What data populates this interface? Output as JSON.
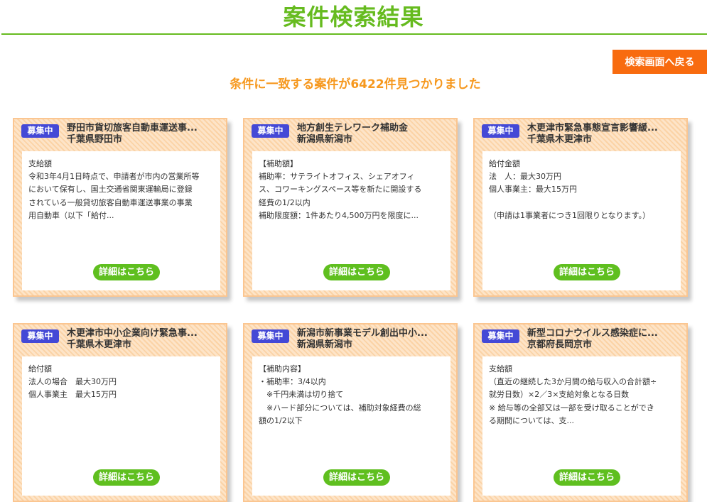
{
  "colors": {
    "title_green": "#66bb1f",
    "accent_orange": "#f6981e",
    "button_orange": "#f86b0f",
    "card_border": "#fbc691",
    "badge_blue": "#4449d6",
    "detail_green": "#5fbf1f"
  },
  "page": {
    "title": "案件検索結果",
    "back_button": "検索画面へ戻る",
    "result_summary": "条件に一致する案件が6422件見つかりました"
  },
  "cards": [
    {
      "status": "募集中",
      "title": "野田市貨切旅客自動車運送事...",
      "location": "千葉県野田市",
      "text": "支給額\n令和3年4月1日時点で、申請者が市内の営業所等\nにおいて保有し、国土交通省関東運輸局に登録\nされている一般貸切旅客自動車運送事業の事業\n用自動車（以下「給付...",
      "detail_label": "詳細はこちら"
    },
    {
      "status": "募集中",
      "title": "地方創生テレワーク補助金",
      "location": "新潟県新潟市",
      "text": "【補助額】\n補助率：サテライトオフィス、シェアオフィ\nス、コワーキングスペース等を新たに開設する\n経費の1/2以内\n補助限度額：1件あたり4,500万円を限度に...",
      "detail_label": "詳細はこちら"
    },
    {
      "status": "募集中",
      "title": "木更津市緊急事態宣言影響緩...",
      "location": "千葉県木更津市",
      "text": "給付金額\n法　人：最大30万円\n個人事業主：最大15万円\n\n（申請は1事業者につき1回限りとなります。）",
      "detail_label": "詳細はこちら"
    },
    {
      "status": "募集中",
      "title": "木更津市中小企業向け緊急事...",
      "location": "千葉県木更津市",
      "text": "給付額\n法人の場合　最大30万円\n個人事業主　最大15万円",
      "detail_label": "詳細はこちら"
    },
    {
      "status": "募集中",
      "title": "新潟市新事業モデル創出中小...",
      "location": "新潟県新潟市",
      "text": "【補助内容】\n・補助率：3/4以内\n　※千円未満は切り捨て\n　※ハード部分については、補助対象経費の総\n額の1/2以下",
      "detail_label": "詳細はこちら"
    },
    {
      "status": "募集中",
      "title": "新型コロナウイルス感染症に...",
      "location": "京都府長岡京市",
      "text": "支給額\n（直近の継続した3か月間の給与収入の合計額÷\n就労日数）×2／3×支給対象となる日数\n※ 給与等の全部又は一部を受け取ることができ\nる期間については、支...",
      "detail_label": "詳細はこちら"
    }
  ]
}
